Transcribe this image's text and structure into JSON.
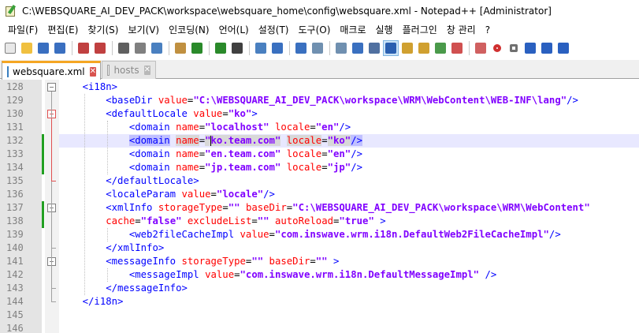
{
  "window": {
    "title": "C:\\WEBSQUARE_AI_DEV_PACK\\workspace\\websquare_home\\config\\websquare.xml - Notepad++ [Administrator]"
  },
  "menu": [
    "파일(F)",
    "편집(E)",
    "찾기(S)",
    "보기(V)",
    "인코딩(N)",
    "언어(L)",
    "설정(T)",
    "도구(O)",
    "매크로",
    "실행",
    "플러그인",
    "창 관리",
    "?"
  ],
  "tabs": [
    {
      "label": "websquare.xml",
      "active": true
    },
    {
      "label": "hosts",
      "active": false
    }
  ],
  "colors": {
    "tag": "#0000ff",
    "attribute": "#ff0000",
    "value": "#8000ff",
    "current_line": "#e8e8ff",
    "change_marker": "#22a022",
    "active_tab_accent": "#f5a623"
  },
  "editor": {
    "current_line": 132,
    "lines": [
      {
        "n": "128",
        "text": "    <i18n>"
      },
      {
        "n": "129",
        "text": "        <baseDir value=\"C:\\WEBSQUARE_AI_DEV_PACK\\workspace\\WRM\\WebContent\\WEB-INF\\lang\"/>"
      },
      {
        "n": "130",
        "text": "        <defaultLocale value=\"ko\">"
      },
      {
        "n": "131",
        "text": "            <domain name=\"localhost\" locale=\"en\"/>"
      },
      {
        "n": "132",
        "text": "            <domain name=\"ko.team.com\" locale=\"ko\"/>"
      },
      {
        "n": "133",
        "text": "            <domain name=\"en.team.com\" locale=\"en\"/>"
      },
      {
        "n": "134",
        "text": "            <domain name=\"jp.team.com\" locale=\"jp\"/>"
      },
      {
        "n": "135",
        "text": "        </defaultLocale>"
      },
      {
        "n": "136",
        "text": "        <localeParam value=\"locale\"/>"
      },
      {
        "n": "137",
        "text": "        <xmlInfo storageType=\"\" baseDir=\"C:\\WEBSQUARE_AI_DEV_PACK\\workspace\\WRM\\WebContent\""
      },
      {
        "n": "138",
        "text": "        cache=\"false\" excludeList=\"\" autoReload=\"true\" >"
      },
      {
        "n": "139",
        "text": "            <web2fileCacheImpl value=\"com.inswave.wrm.i18n.DefaultWeb2FileCacheImpl\"/>"
      },
      {
        "n": "140",
        "text": "        </xmlInfo>"
      },
      {
        "n": "141",
        "text": "        <messageInfo storageType=\"\" baseDir=\"\" >"
      },
      {
        "n": "142",
        "text": "            <messageImpl value=\"com.inswave.wrm.i18n.DefaultMessageImpl\" />"
      },
      {
        "n": "143",
        "text": "        </messageInfo>"
      },
      {
        "n": "144",
        "text": "    </i18n>"
      },
      {
        "n": "145",
        "text": ""
      },
      {
        "n": "146",
        "text": ""
      }
    ]
  },
  "toolbar_icons": [
    "new-file-icon",
    "open-file-icon",
    "save-icon",
    "save-all-icon",
    "close-icon",
    "close-all-icon",
    "print-icon",
    "cut-icon",
    "copy-icon",
    "paste-icon",
    "undo-icon",
    "redo-icon",
    "find-icon",
    "replace-icon",
    "zoom-in-icon",
    "zoom-out-icon",
    "sync-vertical-icon",
    "sync-horizontal-icon",
    "word-wrap-icon",
    "show-all-chars-icon",
    "indent-guide-icon",
    "udl-icon",
    "doc-map-icon",
    "function-list-icon",
    "folder-workspace-icon",
    "monitoring-icon",
    "record-macro-icon",
    "stop-record-icon",
    "play-macro-icon",
    "run-macro-multiple-icon",
    "save-macro-icon"
  ]
}
